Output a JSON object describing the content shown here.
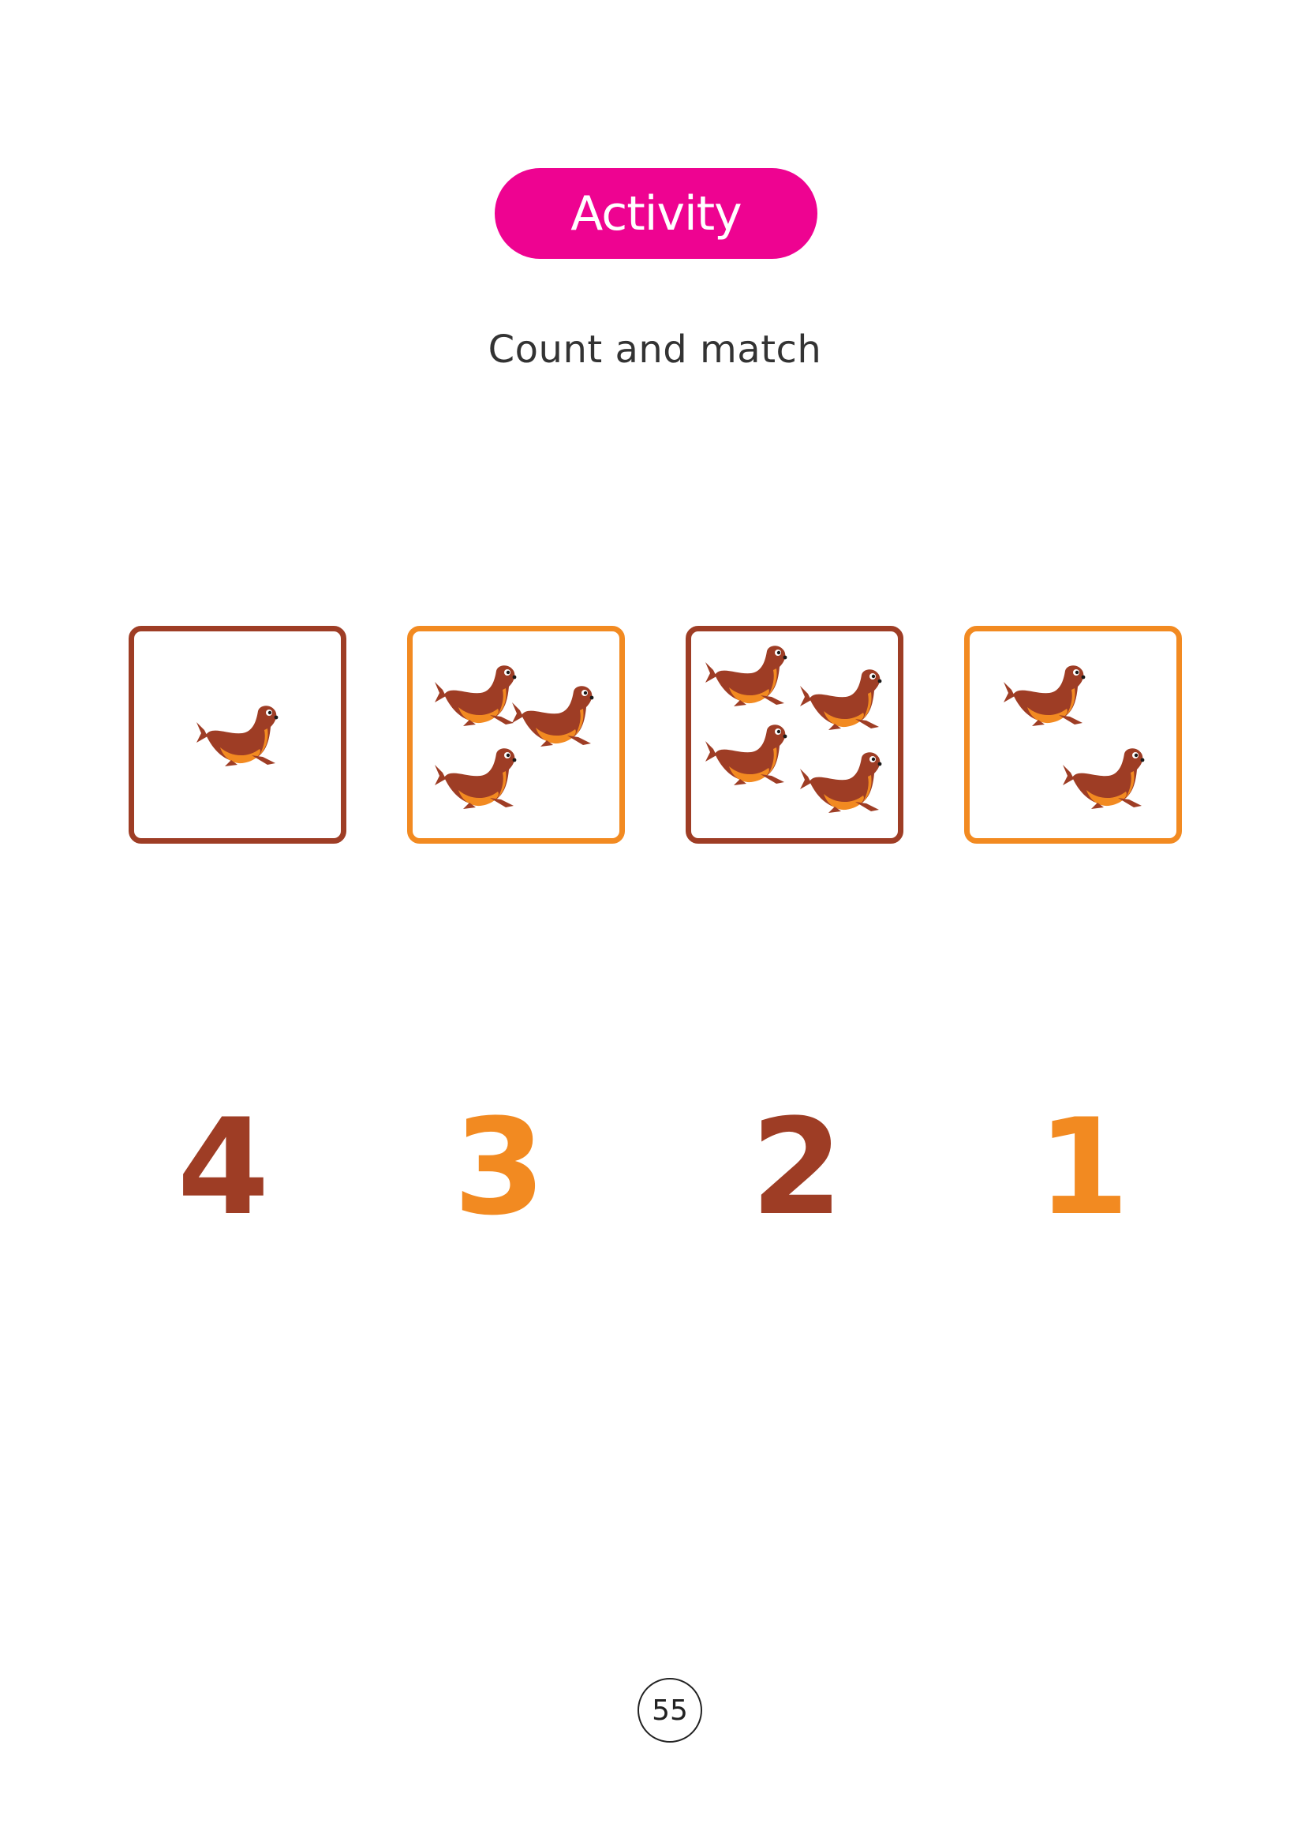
{
  "header": {
    "badge_label": "Activity",
    "instruction": "Count and match"
  },
  "colors": {
    "badge_bg": "#ee0391",
    "brown": "#9e3d25",
    "orange": "#f28a21",
    "seal_body": "#9e3d25",
    "seal_belly": "#f28a21"
  },
  "picture_boxes": [
    {
      "seal_count": 1,
      "border_color": "brown"
    },
    {
      "seal_count": 3,
      "border_color": "orange"
    },
    {
      "seal_count": 4,
      "border_color": "brown"
    },
    {
      "seal_count": 2,
      "border_color": "orange"
    }
  ],
  "numbers": [
    {
      "label": "4",
      "color": "brown"
    },
    {
      "label": "3",
      "color": "orange"
    },
    {
      "label": "2",
      "color": "brown"
    },
    {
      "label": "1",
      "color": "orange"
    }
  ],
  "footer": {
    "page_number": "55"
  }
}
